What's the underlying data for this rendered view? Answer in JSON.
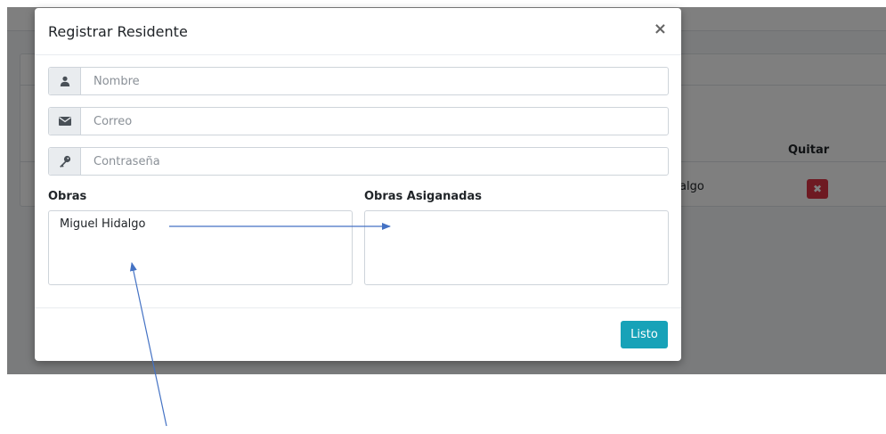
{
  "background": {
    "column_header": "Quitar",
    "row_cell": "algo",
    "delete_glyph": "✖"
  },
  "modal": {
    "title": "Registrar Residente",
    "close_glyph": "×",
    "fields": {
      "name_placeholder": "Nombre",
      "email_placeholder": "Correo",
      "password_placeholder": "Contraseña"
    },
    "lists": {
      "available_label": "Obras",
      "assigned_label": "Obras Asiganadas",
      "available_items": [
        "Miguel Hidalgo"
      ],
      "assigned_items": []
    },
    "footer": {
      "done_label": "Listo"
    }
  },
  "icons": {
    "name": "user-icon",
    "email": "envelope-icon",
    "password": "key-icon",
    "close": "close-icon"
  },
  "colors": {
    "primary": "#007bff",
    "info": "#17a2b8",
    "danger": "#dc3545",
    "annotation_arrow": "#4472c4"
  }
}
